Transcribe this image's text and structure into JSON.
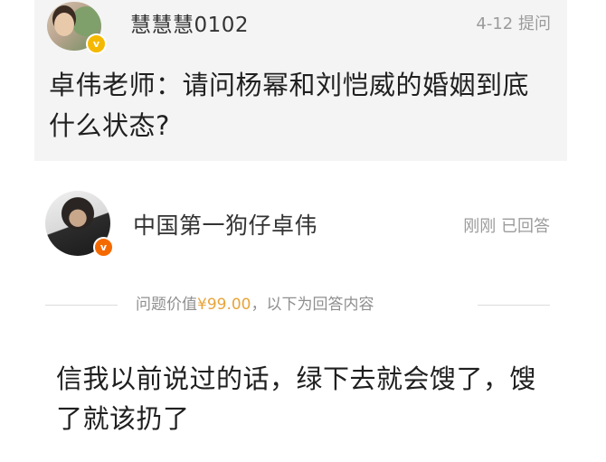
{
  "question": {
    "asker_name": "慧慧慧0102",
    "date": "4-12",
    "action": "提问",
    "text": "卓伟老师：请问杨幂和刘恺威的婚姻到底什么状态?"
  },
  "answer": {
    "answerer_name": "中国第一狗仔卓伟",
    "time": "刚刚",
    "status": "已回答",
    "divider_prefix": "问题价值",
    "price": "¥99.00",
    "divider_suffix": "，以下为回答内容",
    "text": "信我以前说过的话，绿下去就会馊了，馊了就该扔了"
  },
  "badges": {
    "asker_badge": "v",
    "answerer_badge": "v"
  },
  "colors": {
    "asker_badge": "#f5b800",
    "answerer_badge": "#f56a00",
    "price": "#e8a43a",
    "question_background": "#f4f4f4"
  },
  "icons": {
    "asker_avatar": "user-avatar",
    "answerer_avatar": "user-avatar",
    "verified_badge": "verified-v-icon"
  }
}
